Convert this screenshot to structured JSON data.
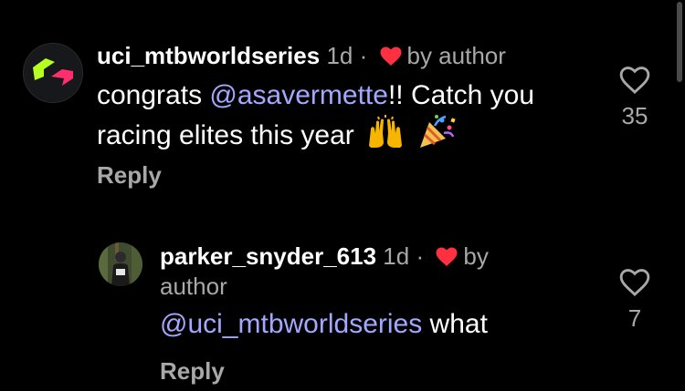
{
  "comments": [
    {
      "username": "uci_mtbworldseries",
      "time": "1d",
      "separator": "·",
      "liked_by": "by author",
      "mention": "@asavermette",
      "text_after_mention": "!! Catch you racing elites this year",
      "text_before_mention": "congrats ",
      "emojis": [
        "raising-hands-emoji",
        "party-popper-emoji"
      ],
      "reply_label": "Reply",
      "like_count": "35",
      "accent_colors": [
        "#b6ff1e",
        "#ff2f6d"
      ]
    },
    {
      "username": "parker_snyder_613",
      "time": "1d",
      "separator": "·",
      "liked_by_line1": "by",
      "liked_by_line2": "author",
      "mention": "@uci_mtbworldseries",
      "text_after_mention": " what",
      "reply_label": "Reply",
      "like_count": "7"
    }
  ],
  "colors": {
    "background": "#000000",
    "text": "#ffffff",
    "secondary": "#a8a8a8",
    "mention": "#a3a8ff",
    "heart": "#ff3040"
  }
}
